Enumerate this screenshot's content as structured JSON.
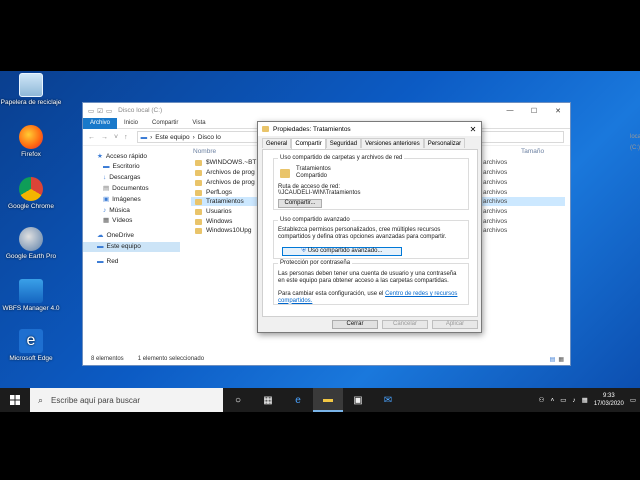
{
  "desktop": {
    "icons": [
      {
        "label": "Papelera de reciclaje"
      },
      {
        "label": "Firefox"
      },
      {
        "label": "Google Chrome"
      },
      {
        "label": "Google Earth Pro"
      },
      {
        "label": "WBFS Manager 4.0"
      },
      {
        "label": "Microsoft Edge"
      }
    ]
  },
  "explorer": {
    "title": "Disco local (C:)",
    "ribbon_tabs": [
      "Archivo",
      "Inicio",
      "Compartir",
      "Vista"
    ],
    "address": [
      "Este equipo",
      "Disco lo"
    ],
    "search_placeholder": "local (C:)",
    "nav": {
      "quick_access": "Acceso rápido",
      "items": [
        "Escritorio",
        "Descargas",
        "Documentos",
        "Imágenes",
        "Música",
        "Vídeos"
      ],
      "onedrive": "OneDrive",
      "this_pc": "Este equipo",
      "network": "Red"
    },
    "column_name": "Nombre",
    "column_size": "Tamaño",
    "files": [
      {
        "name": "$WINDOWS.~BT",
        "type": "archivos"
      },
      {
        "name": "Archivos de prog",
        "type": "archivos"
      },
      {
        "name": "Archivos de prog",
        "type": "archivos"
      },
      {
        "name": "PerfLogs",
        "type": "archivos"
      },
      {
        "name": "Tratamientos",
        "type": "archivos"
      },
      {
        "name": "Usuarios",
        "type": "archivos"
      },
      {
        "name": "Windows",
        "type": "archivos"
      },
      {
        "name": "Windows10Upg",
        "type": "archivos"
      }
    ],
    "status": {
      "count": "8 elementos",
      "selected": "1 elemento seleccionado"
    }
  },
  "properties": {
    "title": "Propiedades: Tratamientos",
    "tabs": [
      "General",
      "Compartir",
      "Seguridad",
      "Versiones anteriores",
      "Personalizar"
    ],
    "net_sharing_title": "Uso compartido de carpetas y archivos de red",
    "folder_name": "Tratamientos",
    "folder_state": "Compartido",
    "path_label": "Ruta de acceso de red:",
    "path_value": "\\\\JCAUDELI-WIN\\Tratamientos",
    "share_button": "Compartir...",
    "advanced_title": "Uso compartido avanzado",
    "advanced_text": "Establezca permisos personalizados, cree múltiples recursos compartidos y defina otras opciones avanzadas para compartir.",
    "advanced_button": "Uso compartido avanzado...",
    "password_title": "Protección por contraseña",
    "password_text": "Las personas deben tener una cuenta de usuario y una contraseña en este equipo para obtener acceso a las carpetas compartidas.",
    "password_text2": "Para cambiar esta configuración, use el",
    "password_link": "Centro de redes y recursos compartidos.",
    "ok_button": "Cerrar",
    "cancel_button": "Cancelar",
    "apply_button": "Aplicar"
  },
  "taskbar": {
    "search_placeholder": "Escribe aquí para buscar",
    "time": "9:33",
    "date": "17/03/2020"
  }
}
